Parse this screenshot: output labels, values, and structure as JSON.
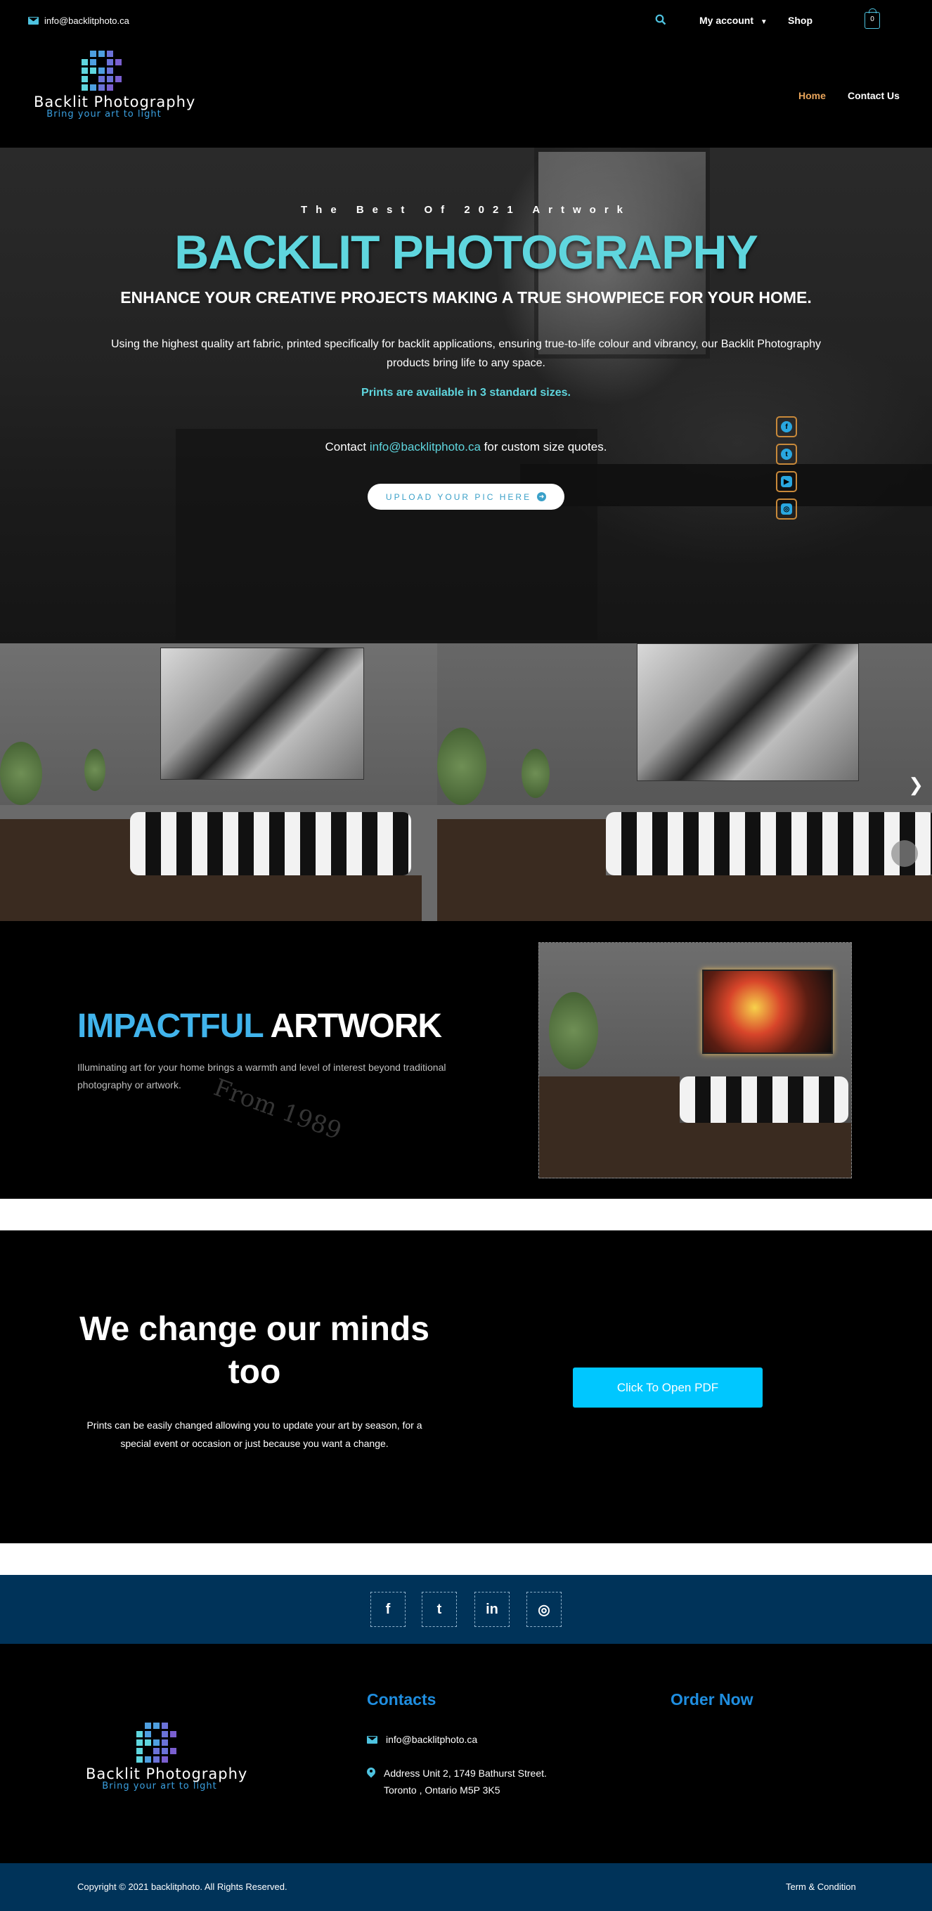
{
  "topbar": {
    "email": "info@backlitphoto.ca",
    "account_label": "My account",
    "shop_label": "Shop",
    "cart_count": "0"
  },
  "brand": {
    "name": "Backlit Photography",
    "tagline": "Bring your art to light"
  },
  "nav": {
    "items": [
      {
        "label": "Home",
        "active": true
      },
      {
        "label": "Contact Us",
        "active": false
      }
    ]
  },
  "hero": {
    "kicker": "The Best Of 2021 Artwork",
    "title": "BACKLIT PHOTOGRAPHY",
    "subtitle": "ENHANCE YOUR CREATIVE PROJECTS MAKING A TRUE SHOWPIECE FOR YOUR HOME.",
    "description": "Using the highest quality art fabric, printed specifically for backlit applications, ensuring true-to-life colour and vibrancy, our Backlit Photography products bring life to any space.",
    "sizes_note": "Prints are available in 3 standard sizes.",
    "contact_prefix": "Contact",
    "contact_email": "info@backlitphoto.ca",
    "contact_suffix": "for custom size quotes.",
    "upload_button": "UPLOAD YOUR PIC HERE",
    "social": [
      "facebook-icon",
      "twitter-icon",
      "youtube-icon",
      "instagram-icon"
    ]
  },
  "impact": {
    "heading_accent": "IMPACTFUL",
    "heading_rest": "ARTWORK",
    "text": "Illuminating art for your home brings a warmth and level of interest beyond traditional photography or artwork.",
    "watermark": "From 1989"
  },
  "change": {
    "heading": "We change our minds too",
    "text": "Prints can be easily changed allowing you to update your art by season, for a special event or occasion or just because you want a change.",
    "button": "Click To Open PDF"
  },
  "social_band": {
    "icons": [
      "facebook-icon",
      "twitter-icon",
      "linkedin-icon",
      "instagram-icon"
    ],
    "glyphs": [
      "f",
      "t",
      "in",
      "◎"
    ]
  },
  "footer": {
    "contacts_heading": "Contacts",
    "order_heading": "Order Now",
    "email": "info@backlitphoto.ca",
    "address_line1": "Address Unit 2, 1749 Bathurst Street.",
    "address_line2": "Toronto , Ontario M5P 3K5"
  },
  "copyright": {
    "text": "Copyright © 2021 backlitphoto. All Rights Reserved.",
    "terms": "Term & Condition"
  },
  "colors": {
    "accent_cyan": "#5fd6de",
    "accent_blue": "#41b4ec",
    "nav_active": "#e8a45a",
    "button_cyan": "#00c7ff",
    "band_navy": "#003359"
  }
}
